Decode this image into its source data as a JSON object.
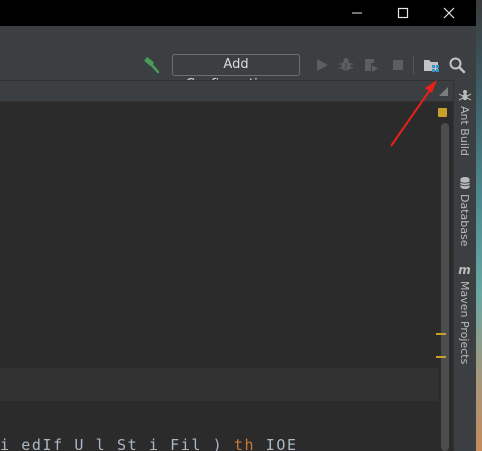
{
  "window": {
    "minimize_glyph": "—",
    "maximize_glyph": "☐",
    "close_glyph": "✕"
  },
  "toolbar": {
    "build_icon": "hammer-icon",
    "run_configuration_label": "Add Configuration...",
    "run_icon": "run-icon",
    "debug_icon": "debug-icon",
    "coverage_icon": "coverage-icon",
    "stop_icon": "stop-icon",
    "project_structure_icon": "project-structure-icon",
    "search_icon": "search-icon"
  },
  "editor": {
    "code_line": {
      "prefix": "  i    edIf U l St i  Fil    ) ",
      "keyword": "th",
      "suffix": "    IOE"
    }
  },
  "right_sidebar": {
    "tabs": [
      {
        "label": "Ant Build",
        "icon": "ant-icon"
      },
      {
        "label": "Database",
        "icon": "database-icon"
      },
      {
        "label": "Maven Projects",
        "icon": "maven-icon"
      }
    ]
  },
  "colors": {
    "toolbar_bg": "#3c3f41",
    "editor_bg": "#2b2b2b",
    "accent_green": "#499c54",
    "annotation_arrow": "#e8201a",
    "warning_yellow": "#c7a02c"
  }
}
